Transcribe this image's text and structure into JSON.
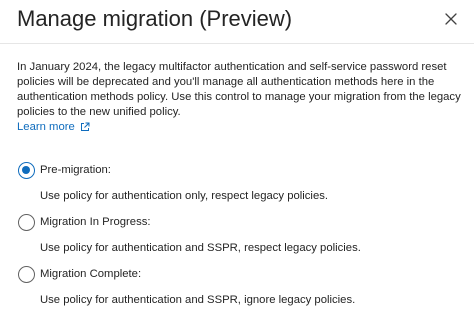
{
  "header": {
    "title": "Manage migration (Preview)",
    "close_icon": "close-icon"
  },
  "description": "In January 2024, the legacy multifactor authentication and self-service password reset policies will be deprecated and you'll manage all authentication methods here in the authentication methods policy. Use this control to manage your migration from the legacy policies to the new unified policy.",
  "learn_more": {
    "label": "Learn more",
    "icon": "open-external-icon"
  },
  "options": [
    {
      "label": "Pre-migration:",
      "description": "Use policy for authentication only, respect legacy policies.",
      "selected": true
    },
    {
      "label": "Migration In Progress:",
      "description": "Use policy for authentication and SSPR, respect legacy policies.",
      "selected": false
    },
    {
      "label": "Migration Complete:",
      "description": "Use policy for authentication and SSPR, ignore legacy policies.",
      "selected": false
    }
  ],
  "colors": {
    "accent": "#0f6cbd",
    "text": "#242424"
  }
}
